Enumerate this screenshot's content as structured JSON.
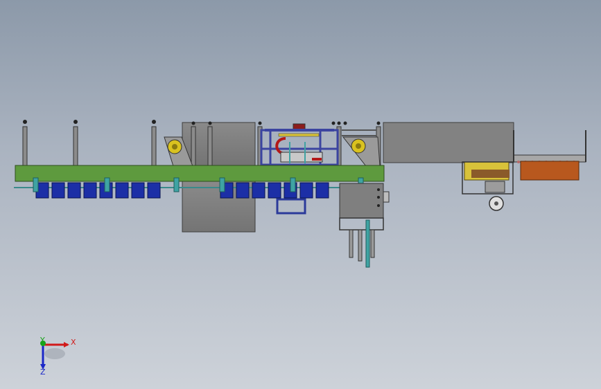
{
  "view": {
    "type": "cad-model-viewport",
    "background_top": "#8c99a9",
    "background_bottom": "#cdd2d9"
  },
  "colors": {
    "frame_green": "#5e9a3e",
    "frame_blue": "#3b44a0",
    "cup_blue": "#1c2fa6",
    "teal": "#3fa3a3",
    "panel_gray": "#7f7f7f",
    "orange_tray": "#b8581e",
    "yellow_part": "#d8c23a",
    "red_part": "#8c1d1d"
  },
  "axis_triad": {
    "x_label": "X",
    "y_label": "Y",
    "z_label": "Z",
    "x_color": "#d11a1a",
    "y_color": "#19a319",
    "z_color": "#1b27c7"
  }
}
